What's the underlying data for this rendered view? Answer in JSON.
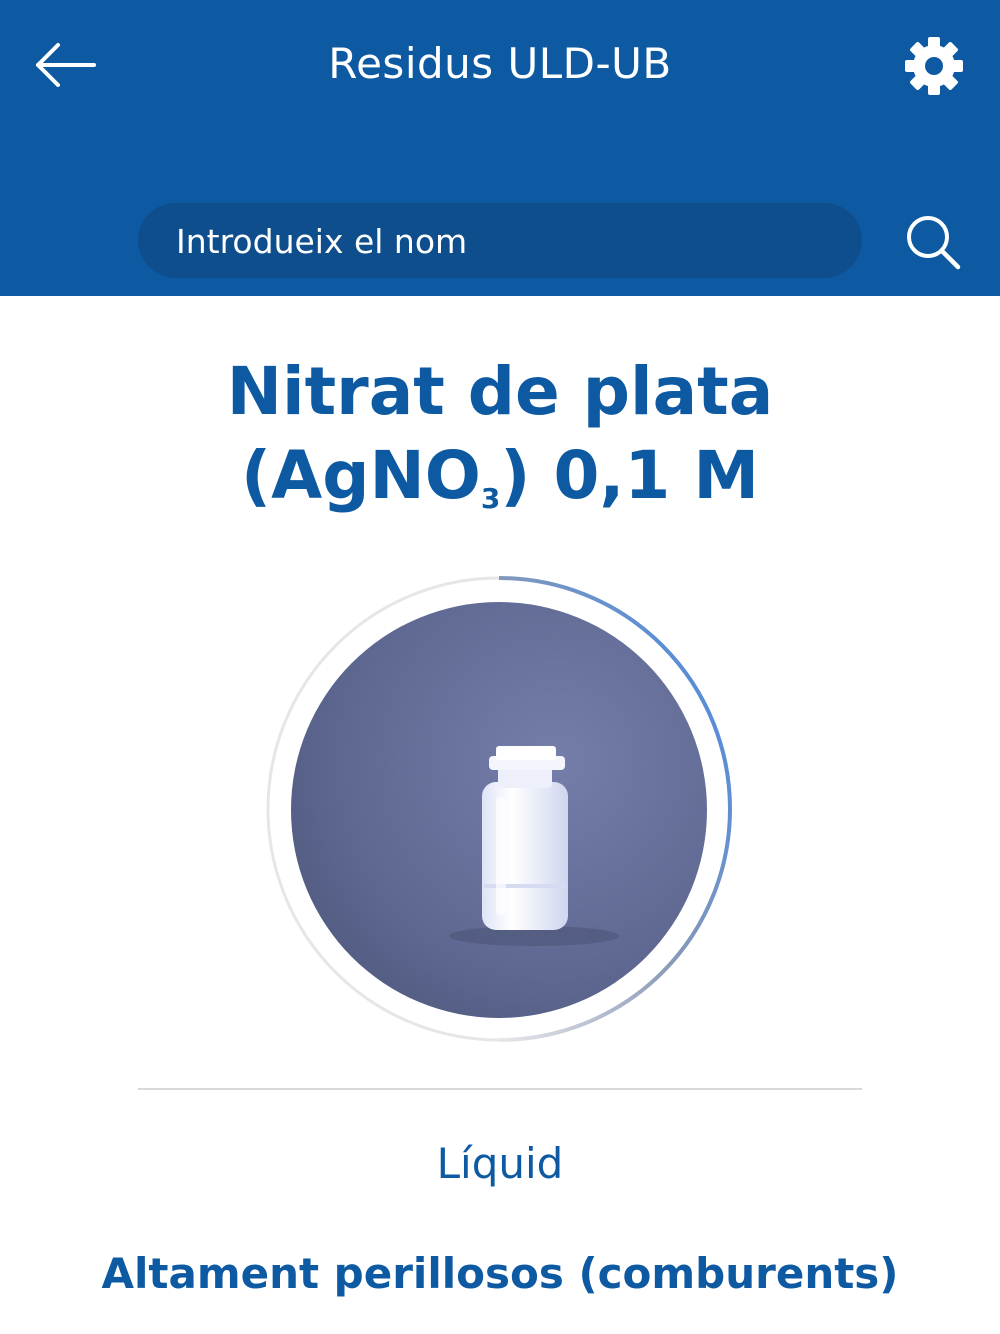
{
  "header": {
    "title": "Residus ULD-UB",
    "back_icon": "arrow-left-icon",
    "settings_icon": "gear-icon",
    "background_color": "#0d5aa3"
  },
  "search": {
    "placeholder": "Introdueix el nom",
    "icon": "search-icon"
  },
  "product": {
    "name_line1": "Nitrat de plata",
    "name_prefix": "(AgNO",
    "name_subscript": "3",
    "name_suffix": ") 0,1 M",
    "image": "white-plastic-bottle",
    "state": "Líquid",
    "category": "Altament perillosos (comburents)"
  },
  "colors": {
    "accent": "#0d5aa3",
    "search_bg": "#0e4e8c",
    "ring_gradient": "#3f86e6"
  }
}
